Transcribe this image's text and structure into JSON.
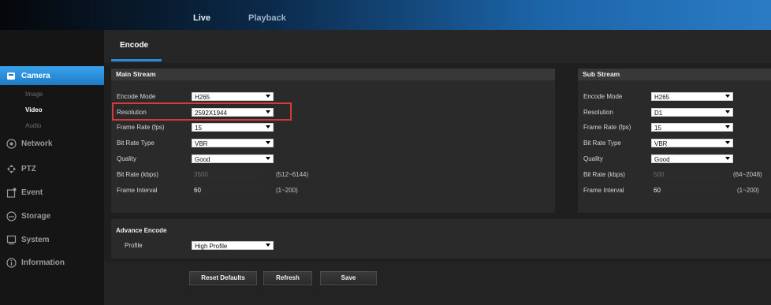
{
  "top_nav": {
    "live": "Live",
    "playback": "Playback"
  },
  "sidebar": {
    "items": [
      {
        "label": "Camera",
        "icon": "camera-icon"
      },
      {
        "label": "Network",
        "icon": "network-icon"
      },
      {
        "label": "PTZ",
        "icon": "ptz-icon"
      },
      {
        "label": "Event",
        "icon": "event-icon"
      },
      {
        "label": "Storage",
        "icon": "storage-icon"
      },
      {
        "label": "System",
        "icon": "system-icon"
      },
      {
        "label": "Information",
        "icon": "info-icon"
      }
    ],
    "camera_sub": [
      "Image",
      "Video",
      "Audio"
    ]
  },
  "tab": {
    "label": "Encode"
  },
  "main_stream": {
    "title": "Main Stream",
    "labels": [
      "Encode Mode",
      "Resolution",
      "Frame Rate (fps)",
      "Bit Rate Type",
      "Quality",
      "Bit Rate (kbps)",
      "Frame Interval"
    ],
    "encode_mode": "H265",
    "resolution": "2592X1944",
    "frame_rate": "15",
    "bit_rate_type": "VBR",
    "quality": "Good",
    "bit_rate": "3500",
    "bit_rate_hint": "(512~6144)",
    "frame_interval": "60",
    "frame_interval_hint": "(1~200)"
  },
  "sub_stream": {
    "title": "Sub Stream",
    "labels": [
      "Encode Mode",
      "Resolution",
      "Frame Rate (fps)",
      "Bit Rate Type",
      "Quality",
      "Bit Rate (kbps)",
      "Frame Interval"
    ],
    "encode_mode": "H265",
    "resolution": "D1",
    "frame_rate": "15",
    "bit_rate_type": "VBR",
    "quality": "Good",
    "bit_rate": "500",
    "bit_rate_hint": "(64~2048)",
    "frame_interval": "60",
    "frame_interval_hint": "(1~200)"
  },
  "advance": {
    "title": "Advance Encode",
    "profile_label": "Profile",
    "profile": "High Profile"
  },
  "buttons": {
    "reset": "Reset Defaults",
    "refresh": "Refresh",
    "save": "Save"
  },
  "colors": {
    "accent": "#2a8ad8",
    "highlight": "#d43a3a"
  }
}
